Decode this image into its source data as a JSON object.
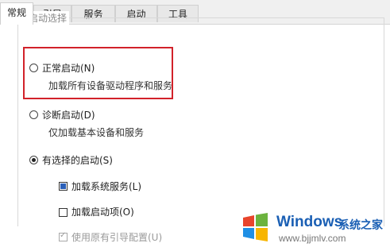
{
  "tabs": [
    {
      "label": "常规",
      "active": true
    },
    {
      "label": "引导",
      "active": false
    },
    {
      "label": "服务",
      "active": false
    },
    {
      "label": "启动",
      "active": false
    },
    {
      "label": "工具",
      "active": false
    }
  ],
  "startup_group": {
    "label": "启动选择",
    "normal": {
      "label": "正常启动(N)",
      "description": "加载所有设备驱动程序和服务",
      "selected": false
    },
    "diagnostic": {
      "label": "诊断启动(D)",
      "description": "仅加载基本设备和服务",
      "selected": false
    },
    "selective": {
      "label": "有选择的启动(S)",
      "selected": true,
      "options": [
        {
          "label": "加载系统服务(L)",
          "state": "indeterminate",
          "enabled": true
        },
        {
          "label": "加载启动项(O)",
          "state": "unchecked",
          "enabled": true
        },
        {
          "label": "使用原有引导配置(U)",
          "state": "checked",
          "enabled": false
        }
      ]
    }
  },
  "highlight_color": "#d2222a",
  "watermark": {
    "brand": "Windows",
    "brand_suffix": "系统之家",
    "url": "www.bjjmlv.com"
  }
}
